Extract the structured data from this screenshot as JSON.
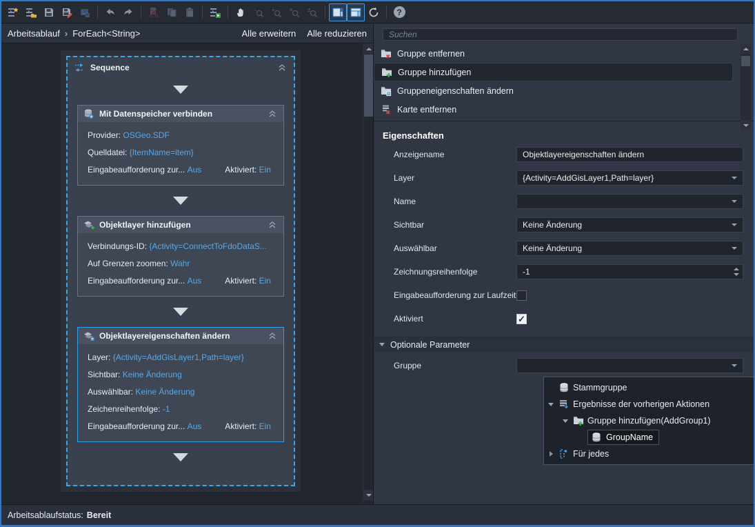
{
  "colors": {
    "window_border": "#2a7ad2",
    "accent_selection": "#2fa0ec",
    "value_blue": "#55a9ea",
    "sequence_dash": "#3aa8e6"
  },
  "toolbar": {
    "buttons": [
      {
        "name": "new-workflow",
        "enabled": true
      },
      {
        "name": "open-workflow",
        "enabled": true
      },
      {
        "name": "save",
        "enabled": true
      },
      {
        "name": "save-as",
        "enabled": true
      },
      {
        "name": "export-image",
        "enabled": false
      },
      {
        "name": "undo",
        "enabled": true
      },
      {
        "name": "redo",
        "enabled": true
      },
      {
        "name": "cut",
        "enabled": false
      },
      {
        "name": "copy",
        "enabled": false
      },
      {
        "name": "paste",
        "enabled": false
      },
      {
        "name": "run",
        "enabled": true
      },
      {
        "name": "pan",
        "enabled": true
      },
      {
        "name": "zoom-out",
        "enabled": false
      },
      {
        "name": "zoom-in",
        "enabled": false
      },
      {
        "name": "zoom-window",
        "enabled": false
      },
      {
        "name": "zoom-extents",
        "enabled": false
      },
      {
        "name": "layout-design",
        "enabled": true,
        "active": true
      },
      {
        "name": "layout-split",
        "enabled": true,
        "active": true
      },
      {
        "name": "refresh",
        "enabled": true
      },
      {
        "name": "help",
        "enabled": true
      }
    ]
  },
  "breadcrumb": {
    "root": "Arbeitsablauf",
    "separator": "›",
    "current": "ForEach<String>",
    "expand_all": "Alle erweitern",
    "collapse_all": "Alle reduzieren"
  },
  "canvas": {
    "sequence_title": "Sequence",
    "activities": [
      {
        "title": "Mit Datenspeicher verbinden",
        "icon": "datastore-connect-icon",
        "selected": false,
        "rows": [
          {
            "label": "Provider:",
            "value": "OSGeo.SDF"
          },
          {
            "label": "Quelldatei:",
            "value": "{ItemName=item}"
          }
        ],
        "footer": {
          "prompt_label": "Eingabeaufforderung zur...",
          "prompt_value": "Aus",
          "enabled_label": "Aktiviert:",
          "enabled_value": "Ein"
        }
      },
      {
        "title": "Objektlayer hinzufügen",
        "icon": "layer-add-icon",
        "selected": false,
        "rows": [
          {
            "label": "Verbindungs-ID:",
            "value": "{Activity=ConnectToFdoDataS..."
          },
          {
            "label": "Auf Grenzen zoomen:",
            "value": "Wahr"
          }
        ],
        "footer": {
          "prompt_label": "Eingabeaufforderung zur...",
          "prompt_value": "Aus",
          "enabled_label": "Aktiviert:",
          "enabled_value": "Ein"
        }
      },
      {
        "title": "Objektlayereigenschaften ändern",
        "icon": "layer-properties-icon",
        "selected": true,
        "rows": [
          {
            "label": "Layer:",
            "value": "{Activity=AddGisLayer1,Path=layer}"
          },
          {
            "label": "Sichtbar:",
            "value": "Keine Änderung"
          },
          {
            "label": "Auswählbar:",
            "value": "Keine Änderung"
          },
          {
            "label": "Zeichenreihenfolge:",
            "value": "-1"
          }
        ],
        "footer": {
          "prompt_label": "Eingabeaufforderung zur...",
          "prompt_value": "Aus",
          "enabled_label": "Aktiviert:",
          "enabled_value": "Ein"
        }
      }
    ]
  },
  "actions": {
    "search_placeholder": "Suchen",
    "items": [
      {
        "label": "Gruppe entfernen",
        "icon": "folder-remove-icon",
        "selected": false
      },
      {
        "label": "Gruppe hinzufügen",
        "icon": "folder-add-icon",
        "selected": true
      },
      {
        "label": "Gruppeneigenschaften ändern",
        "icon": "folder-properties-icon",
        "selected": false
      },
      {
        "label": "Karte entfernen",
        "icon": "map-remove-icon",
        "selected": false
      }
    ]
  },
  "properties": {
    "title": "Eigenschaften",
    "rows": [
      {
        "label": "Anzeigename",
        "type": "text",
        "value": "Objektlayereigenschaften ändern"
      },
      {
        "label": "Layer",
        "type": "dropdown",
        "value": "{Activity=AddGisLayer1,Path=layer}"
      },
      {
        "label": "Name",
        "type": "dropdown",
        "value": ""
      },
      {
        "label": "Sichtbar",
        "type": "dropdown",
        "value": "Keine Änderung"
      },
      {
        "label": "Auswählbar",
        "type": "dropdown",
        "value": "Keine Änderung"
      },
      {
        "label": "Zeichnungsreihenfolge",
        "type": "spinner",
        "value": "-1"
      },
      {
        "label": "Eingabeaufforderung zur Laufzeit",
        "type": "checkbox",
        "checked": false
      },
      {
        "label": "Aktiviert",
        "type": "checkbox",
        "checked": true
      }
    ],
    "optional_section_label": "Optionale Parameter",
    "gruppe_label": "Gruppe",
    "gruppe_value": "",
    "tree": [
      {
        "label": "Stammgruppe",
        "icon": "database-icon",
        "level": 0,
        "expander": "none",
        "selected": false
      },
      {
        "label": "Ergebnisse der vorherigen Aktionen",
        "icon": "results-icon",
        "level": 0,
        "expander": "expanded",
        "selected": false
      },
      {
        "label": "Gruppe hinzufügen(AddGroup1)",
        "icon": "folder-add-icon",
        "level": 1,
        "expander": "expanded",
        "selected": false
      },
      {
        "label": "GroupName",
        "icon": "database-icon",
        "level": 2,
        "expander": "none",
        "selected": true
      },
      {
        "label": "Für jedes",
        "icon": "foreach-icon",
        "level": 0,
        "expander": "collapsed",
        "selected": false
      }
    ]
  },
  "statusbar": {
    "label": "Arbeitsablaufstatus:",
    "value": "Bereit"
  }
}
